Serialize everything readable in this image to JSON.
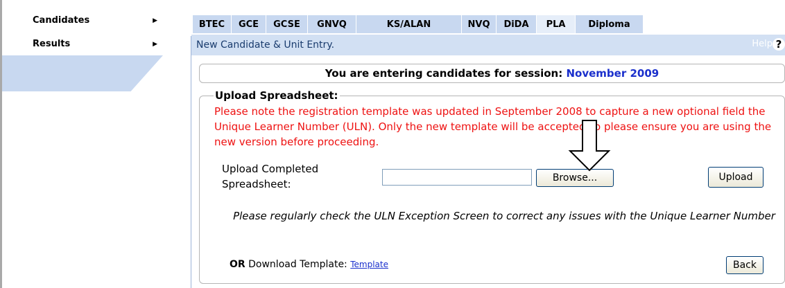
{
  "sidebar": {
    "items": [
      {
        "label": "Candidates",
        "arrow": "▶"
      },
      {
        "label": "Results",
        "arrow": "▶"
      }
    ]
  },
  "tabs": [
    {
      "label": "BTEC"
    },
    {
      "label": "GCE"
    },
    {
      "label": "GCSE"
    },
    {
      "label": "GNVQ"
    },
    {
      "label": "KS/ALAN"
    },
    {
      "label": "NVQ"
    },
    {
      "label": "DiDA"
    },
    {
      "label": "PLA"
    },
    {
      "label": "Diploma"
    }
  ],
  "header": {
    "title": "New Candidate & Unit Entry.",
    "help_label": "Help",
    "help_icon": "?"
  },
  "session": {
    "prefix": "You are entering candidates for session:",
    "value": "November 2009"
  },
  "upload": {
    "legend": "Upload Spreadsheet:",
    "notice": "Please note the registration template was updated in September 2008 to capture a new optional field the Unique Learner Number (ULN). Only the new template will be accepted so please ensure you are using the new version before proceeding.",
    "field_label": "Upload Completed Spreadsheet:",
    "file_value": "",
    "browse_label": "Browse...",
    "upload_label": "Upload",
    "uln_note": "Please regularly check the ULN Exception Screen to correct any issues with the Unique Learner Number",
    "download_or": "OR",
    "download_text": " Download Template: ",
    "template_link": "Template",
    "back_label": "Back"
  },
  "colors": {
    "tab_bg": "#c8d8f0",
    "notice": "#ee1111",
    "session_value": "#1a2fcc"
  }
}
